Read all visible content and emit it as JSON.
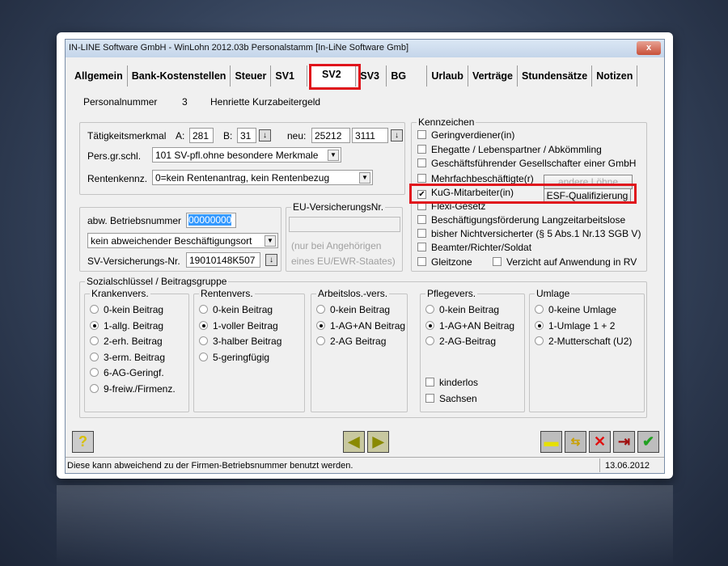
{
  "window": {
    "title": "IN-LINE Software GmbH - WinLohn 2012.03b  Personalstamm [In-LiNe Software Gmb]",
    "close": "x"
  },
  "tabs": [
    "Allgemein",
    "Bank-Kostenstellen",
    "Steuer",
    "SV1",
    "SV2",
    "SV3",
    "BG",
    "Urlaub",
    "Verträge",
    "Stundensätze",
    "Notizen"
  ],
  "employee": {
    "label": "Personalnummer",
    "number": "3",
    "name": "Henriette Kurzabeitergeld"
  },
  "taetigkeit": {
    "label": "Tätigkeitsmerkmal",
    "a_label": "A:",
    "a": "281",
    "b_label": "B:",
    "b": "31",
    "neu_label": "neu:",
    "neu1": "25212",
    "neu2": "3111"
  },
  "persgr": {
    "label": "Pers.gr.schl.",
    "value": "101 SV-pfl.ohne besondere Merkmale"
  },
  "renten": {
    "label": "Rentenkennz.",
    "value": "0=kein Rentenantrag, kein Rentenbezug"
  },
  "betrieb": {
    "label": "abw. Betriebsnummer",
    "value": "00000000",
    "ort": "kein abweichender Beschäftigungsort",
    "sv_label": "SV-Versicherungs-Nr.",
    "sv": "19010148K507"
  },
  "eu": {
    "title": "EU-VersicherungsNr.",
    "value": "",
    "hint1": "(nur bei Angehörigen",
    "hint2": "eines EU/EWR-Staates)"
  },
  "kennzeichen": {
    "title": "Kennzeichen",
    "items": [
      {
        "label": "Geringverdiener(in)",
        "checked": false
      },
      {
        "label": "Ehegatte / Lebenspartner / Abkömmling",
        "checked": false
      },
      {
        "label": "Geschäftsführender Gesellschafter einer GmbH",
        "checked": false
      },
      {
        "label": "Mehrfachbeschäftigte(r)",
        "checked": false
      },
      {
        "label": "KuG-Mitarbeiter(in)",
        "checked": true
      },
      {
        "label": "Flexi-Gesetz",
        "checked": false
      },
      {
        "label": "Beschäftigungsförderung Langzeitarbeitslose",
        "checked": false
      },
      {
        "label": "bisher Nichtversicherter (§ 5 Abs.1 Nr.13 SGB V)",
        "checked": false
      },
      {
        "label": "Beamter/Richter/Soldat",
        "checked": false
      },
      {
        "label": "Gleitzone",
        "checked": false
      },
      {
        "label": "Verzicht auf Anwendung in RV",
        "checked": false
      }
    ],
    "andere_btn": "andere Löhne",
    "esf_btn": "ESF-Qualifizierung"
  },
  "sozial": {
    "title": "Sozialschlüssel / Beitragsgruppe",
    "groups": [
      {
        "title": "Krankenvers.",
        "options": [
          "0-kein Beitrag",
          "1-allg. Beitrag",
          "2-erh. Beitrag",
          "3-erm. Beitrag",
          "6-AG-Geringf.",
          "9-freiw./Firmenz."
        ],
        "selected": 1
      },
      {
        "title": "Rentenvers.",
        "options": [
          "0-kein Beitrag",
          "1-voller Beitrag",
          "3-halber Beitrag",
          "5-geringfügig"
        ],
        "selected": 1
      },
      {
        "title": "Arbeitslos.-vers.",
        "options": [
          "0-kein Beitrag",
          "1-AG+AN Beitrag",
          "2-AG Beitrag"
        ],
        "selected": 1
      },
      {
        "title": "Pflegevers.",
        "options": [
          "0-kein Beitrag",
          "1-AG+AN Beitrag",
          "2-AG-Beitrag"
        ],
        "selected": 1
      },
      {
        "title": "Umlage",
        "options": [
          "0-keine Umlage",
          "1-Umlage 1 + 2",
          "2-Mutterschaft (U2)"
        ],
        "selected": 1
      }
    ],
    "kinderlos": "kinderlos",
    "sachsen": "Sachsen"
  },
  "status": {
    "message": "Diese kann abweichend zu der Firmen-Betriebsnummer benutzt werden.",
    "date": "13.06.2012"
  },
  "colors": {
    "highlight": "#e0141c",
    "selection": "#3399ff"
  }
}
